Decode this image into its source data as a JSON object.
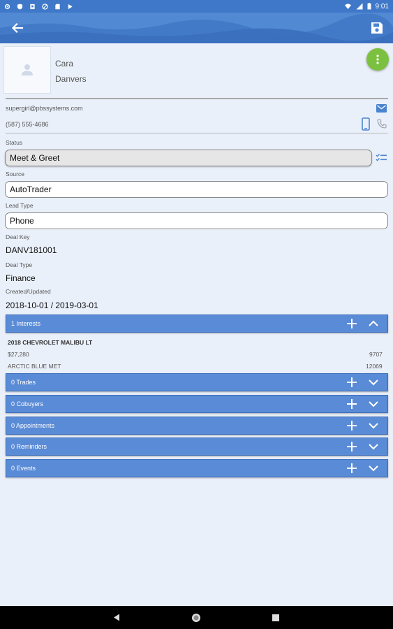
{
  "status_bar": {
    "time": "9:01"
  },
  "contact": {
    "first_name": "Cara",
    "last_name": "Danvers",
    "email": "supergirl@pbssystems.com",
    "phone": "(587) 555-4686"
  },
  "fields": {
    "status_label": "Status",
    "status_value": "Meet & Greet",
    "source_label": "Source",
    "source_value": "AutoTrader",
    "lead_type_label": "Lead Type",
    "lead_type_value": "Phone",
    "deal_key_label": "Deal Key",
    "deal_key_value": "DANV181001",
    "deal_type_label": "Deal Type",
    "deal_type_value": "Finance",
    "created_label": "Created/Updated",
    "created_value": "2018-10-01 / 2019-03-01"
  },
  "sections": [
    {
      "label": "1 Interests",
      "expanded": true
    },
    {
      "label": "0 Trades",
      "expanded": false
    },
    {
      "label": "0 Cobuyers",
      "expanded": false
    },
    {
      "label": "0 Appointments",
      "expanded": false
    },
    {
      "label": "0 Reminders",
      "expanded": false
    },
    {
      "label": "0 Events",
      "expanded": false
    }
  ],
  "interest_item": {
    "name": "2018 CHEVROLET MALIBU LT",
    "price": "$27,280",
    "stock": "9707",
    "color": "ARCTIC BLUE MET",
    "odometer": "12069"
  },
  "icons": {
    "back": "arrow-back-icon",
    "save": "save-icon",
    "more": "more-vert-icon",
    "email": "email-icon",
    "mobile": "smartphone-icon",
    "phone": "phone-icon",
    "status_list": "checklist-icon",
    "add": "add-icon",
    "expand": "chevron-down-icon",
    "collapse": "chevron-up-icon"
  },
  "colors": {
    "app_bar": "#4a84d0",
    "section_header": "#5a8bd6",
    "fab": "#7cc040",
    "background": "#eaf0fa"
  }
}
